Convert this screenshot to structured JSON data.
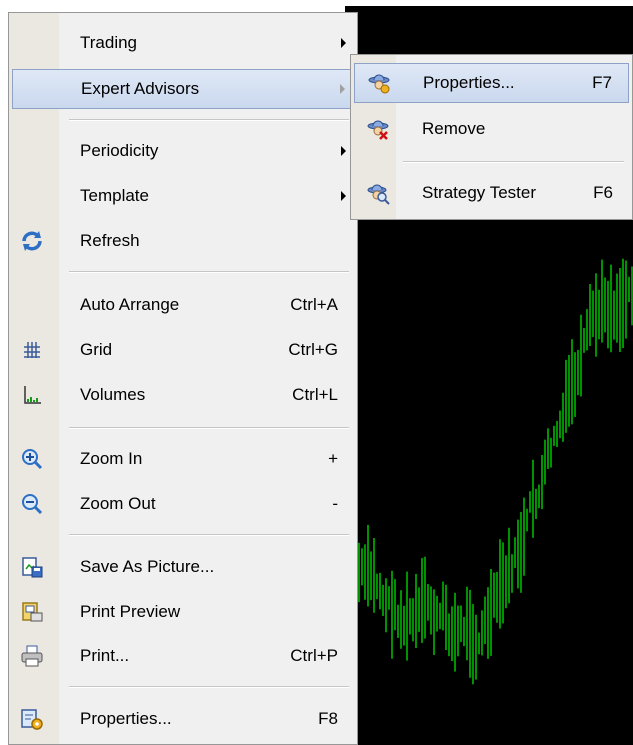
{
  "context_menu": {
    "items": [
      {
        "label": "Trading",
        "submenu": true
      },
      {
        "label": "Expert Advisors",
        "submenu": true,
        "highlighted": true
      },
      {
        "label": "Periodicity",
        "submenu": true
      },
      {
        "label": "Template",
        "submenu": true
      },
      {
        "label": "Refresh",
        "icon": "refresh-icon"
      },
      {
        "label": "Auto Arrange",
        "shortcut": "Ctrl+A"
      },
      {
        "label": "Grid",
        "shortcut": "Ctrl+G",
        "icon": "grid-icon"
      },
      {
        "label": "Volumes",
        "shortcut": "Ctrl+L",
        "icon": "volumes-icon"
      },
      {
        "label": "Zoom In",
        "shortcut": "+",
        "icon": "zoom-in-icon"
      },
      {
        "label": "Zoom Out",
        "shortcut": "-",
        "icon": "zoom-out-icon"
      },
      {
        "label": "Save As Picture...",
        "icon": "save-picture-icon"
      },
      {
        "label": "Print Preview",
        "icon": "print-preview-icon"
      },
      {
        "label": "Print...",
        "shortcut": "Ctrl+P",
        "icon": "printer-icon"
      },
      {
        "label": "Properties...",
        "shortcut": "F8",
        "icon": "properties-icon"
      }
    ]
  },
  "expert_submenu": {
    "items": [
      {
        "label": "Properties...",
        "shortcut": "F7",
        "icon": "expert-properties-icon",
        "highlighted": true
      },
      {
        "label": "Remove",
        "icon": "expert-remove-icon"
      },
      {
        "label": "Strategy Tester",
        "shortcut": "F6",
        "icon": "strategy-tester-icon"
      }
    ]
  },
  "colors": {
    "menu_bg": "#f0f0f0",
    "highlight": "#cad8ee",
    "chart_bg": "#000000",
    "bars": "#00e000"
  }
}
